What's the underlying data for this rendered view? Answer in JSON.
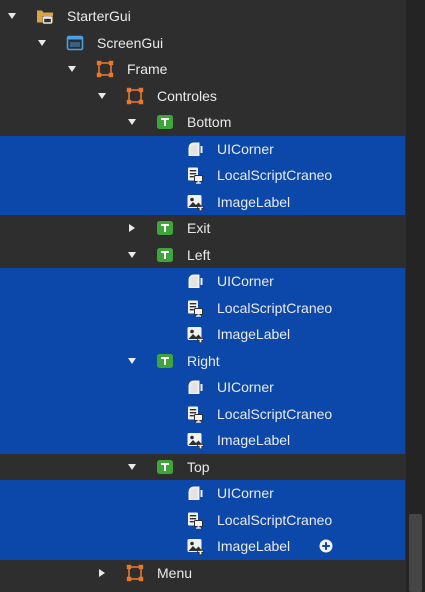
{
  "tree": [
    {
      "label": "StarterGui",
      "icon": "folder-gui-icon",
      "expanded": true,
      "selected": false
    },
    {
      "label": "ScreenGui",
      "icon": "screen-gui-icon",
      "expanded": true,
      "selected": false
    },
    {
      "label": "Frame",
      "icon": "frame-icon",
      "expanded": true,
      "selected": false
    },
    {
      "label": "Controles",
      "icon": "frame-icon",
      "expanded": true,
      "selected": false
    },
    {
      "label": "Bottom",
      "icon": "text-button-icon",
      "expanded": true,
      "selected": false
    },
    {
      "label": "UICorner",
      "icon": "ui-corner-icon",
      "expanded": null,
      "selected": true
    },
    {
      "label": "LocalScriptCraneo",
      "icon": "local-script-icon",
      "expanded": null,
      "selected": true
    },
    {
      "label": "ImageLabel",
      "icon": "image-label-icon",
      "expanded": null,
      "selected": true
    },
    {
      "label": "Exit",
      "icon": "text-button-icon",
      "expanded": false,
      "selected": false
    },
    {
      "label": "Left",
      "icon": "text-button-icon",
      "expanded": true,
      "selected": false
    },
    {
      "label": "UICorner",
      "icon": "ui-corner-icon",
      "expanded": null,
      "selected": true
    },
    {
      "label": "LocalScriptCraneo",
      "icon": "local-script-icon",
      "expanded": null,
      "selected": true
    },
    {
      "label": "ImageLabel",
      "icon": "image-label-icon",
      "expanded": null,
      "selected": true
    },
    {
      "label": "Right",
      "icon": "text-button-icon",
      "expanded": true,
      "selected": true
    },
    {
      "label": "UICorner",
      "icon": "ui-corner-icon",
      "expanded": null,
      "selected": true
    },
    {
      "label": "LocalScriptCraneo",
      "icon": "local-script-icon",
      "expanded": null,
      "selected": true
    },
    {
      "label": "ImageLabel",
      "icon": "image-label-icon",
      "expanded": null,
      "selected": true
    },
    {
      "label": "Top",
      "icon": "text-button-icon",
      "expanded": true,
      "selected": false
    },
    {
      "label": "UICorner",
      "icon": "ui-corner-icon",
      "expanded": null,
      "selected": true
    },
    {
      "label": "LocalScriptCraneo",
      "icon": "local-script-icon",
      "expanded": null,
      "selected": true
    },
    {
      "label": "ImageLabel",
      "icon": "image-label-icon",
      "expanded": null,
      "selected": true,
      "add_button": "add-object-icon"
    },
    {
      "label": "Menu",
      "icon": "frame-icon",
      "expanded": false,
      "selected": false
    }
  ],
  "colors": {
    "background": "#2e2e2e",
    "selection": "#0b48a9",
    "text": "#eaeaea",
    "frame_orange": "#e8772e",
    "button_green": "#3fa53a",
    "screen_blue": "#4aa0e6"
  }
}
